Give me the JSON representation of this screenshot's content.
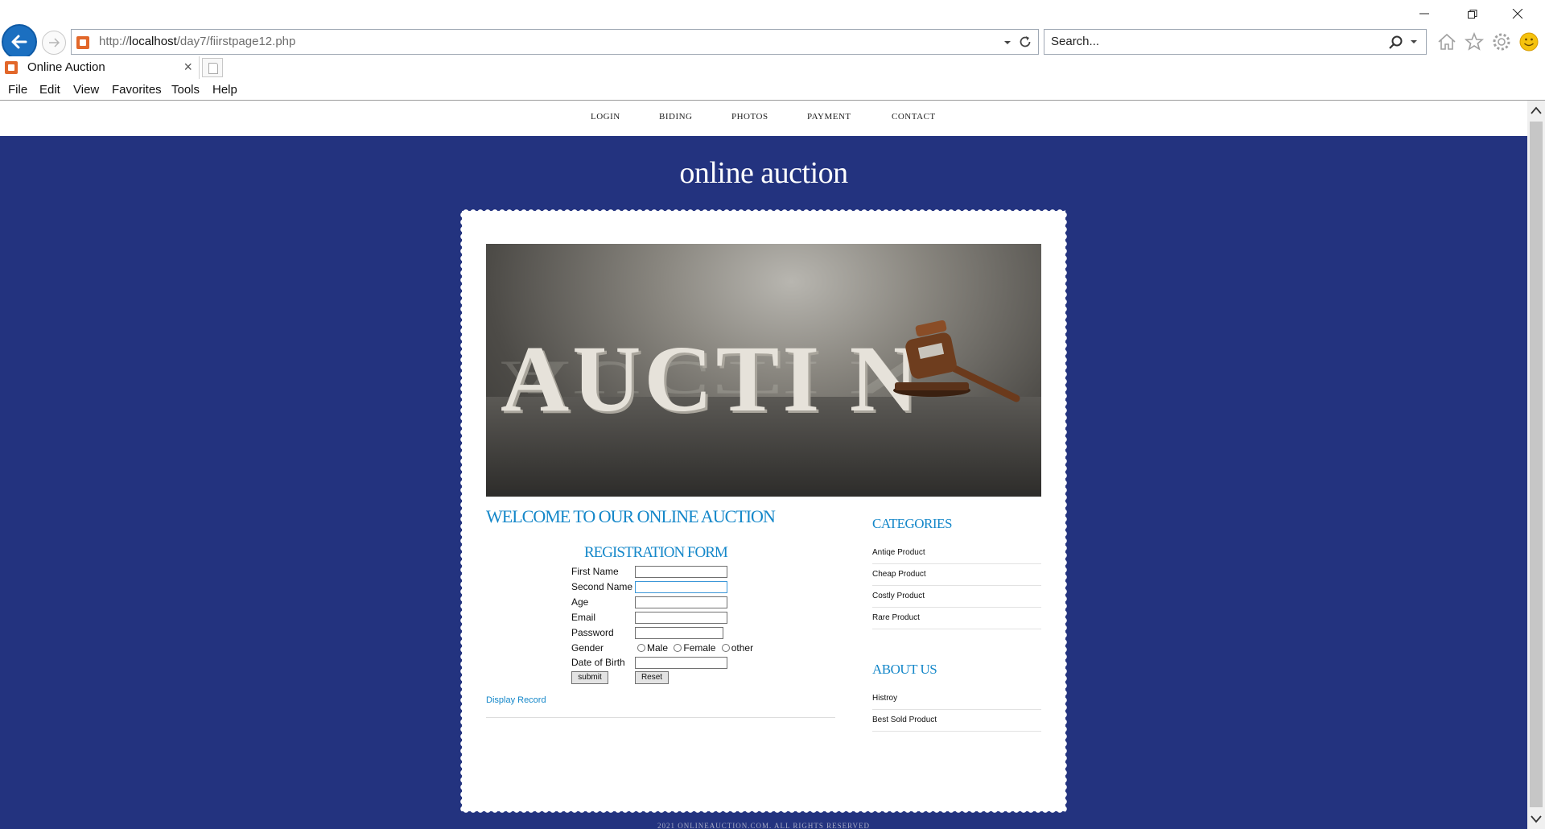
{
  "browser": {
    "url_prefix": "http://",
    "url_host": "localhost",
    "url_path": "/day7/fiirstpage12.php",
    "search_placeholder": "Search...",
    "tab_title": "Online Auction",
    "tab_close": "×",
    "menu": [
      "File",
      "Edit",
      "View",
      "Favorites",
      "Tools",
      "Help"
    ],
    "icons": [
      "back-arrow-icon",
      "forward-arrow-icon",
      "refresh-icon",
      "search-icon",
      "home-icon",
      "star-icon",
      "gear-icon",
      "smiley-icon"
    ]
  },
  "site": {
    "nav": [
      "LOGIN",
      "BIDING",
      "PHOTOS",
      "PAYMENT",
      "CONTACT"
    ],
    "title": "online auction",
    "hero_word": "AUCTI N",
    "welcome": "WELCOME TO OUR ONLINE AUCTION",
    "form": {
      "title": "REGISTRATION FORM",
      "labels": [
        "First Name",
        "Second Name",
        "Age",
        "Email",
        "Password",
        "Gender",
        "Date of Birth"
      ],
      "values": [
        "",
        "",
        "",
        "",
        "",
        ""
      ],
      "gender_options": [
        "Male",
        "Female",
        "other"
      ],
      "submit": "submit",
      "reset": "Reset"
    },
    "display_link": "Display Record",
    "categories": {
      "heading": "CATEGORIES",
      "items": [
        "Antiqe Product",
        "Cheap Product",
        "Costly Product",
        "Rare Product"
      ]
    },
    "about": {
      "heading": "ABOUT US",
      "items": [
        "Histroy",
        "Best Sold Product"
      ]
    },
    "footer": "2021 ONLINEAUCTION.COM. ALL RIGHTS RESERVED"
  },
  "colors": {
    "page_bg": "#23337f",
    "accent": "#1487c9",
    "browser_blue": "#1b6fc0"
  }
}
